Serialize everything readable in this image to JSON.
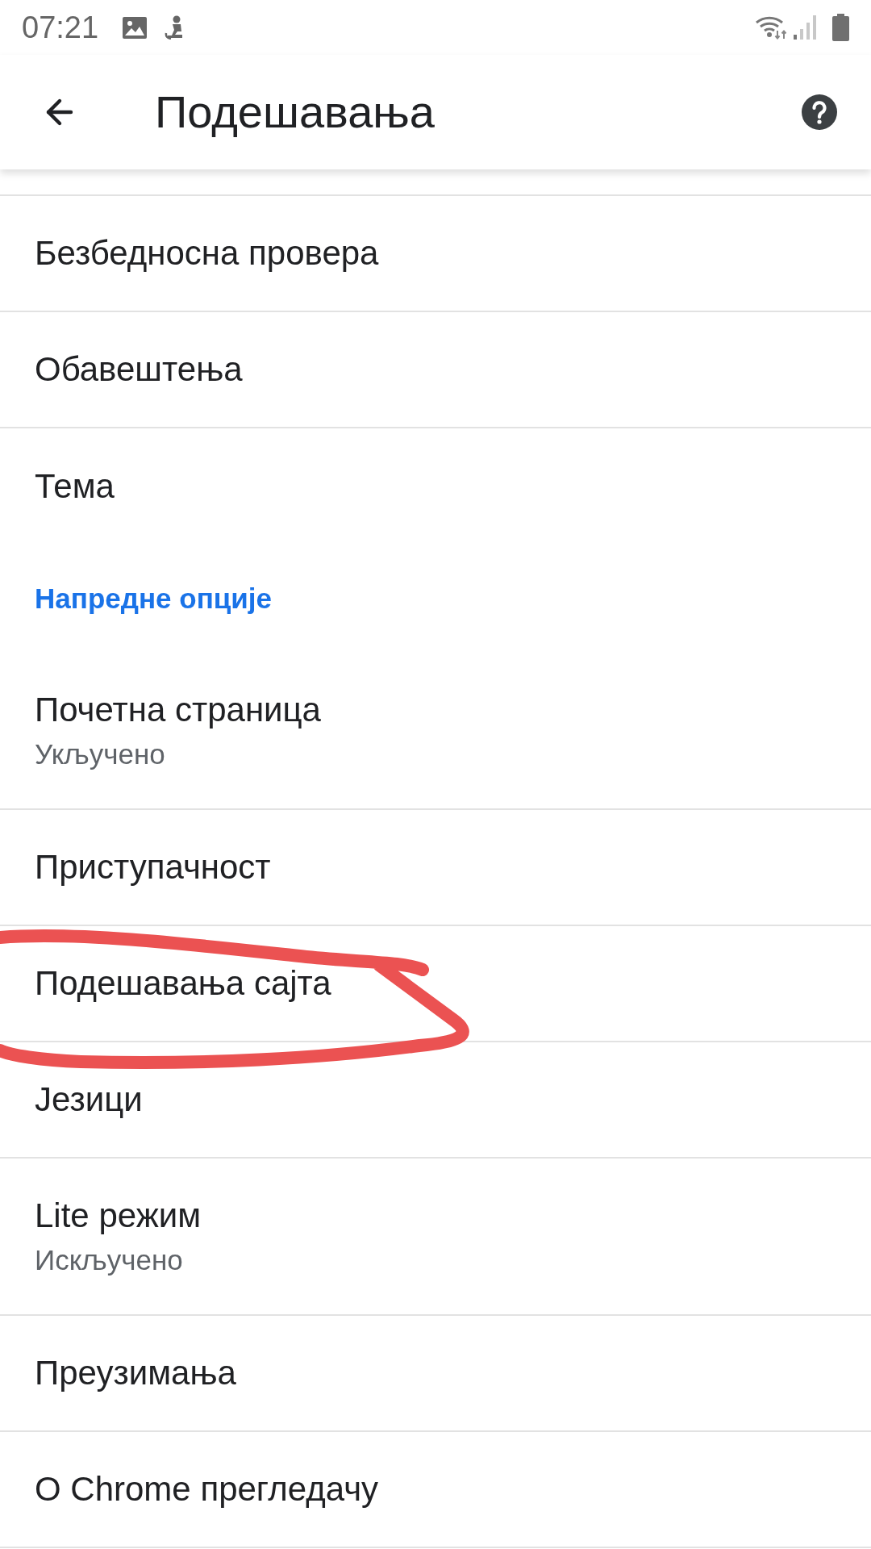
{
  "status_bar": {
    "time": "07:21"
  },
  "app_bar": {
    "title": "Подешавања"
  },
  "settings": [
    {
      "kind": "item",
      "title": "Безбедносна провера",
      "circled": false
    },
    {
      "kind": "item",
      "title": "Обавештења",
      "circled": false
    },
    {
      "kind": "item",
      "title": "Тема",
      "circled": false
    },
    {
      "kind": "header",
      "title": "Напредне опције",
      "circled": false
    },
    {
      "kind": "item",
      "title": "Почетна страница",
      "subtitle": "Укључено",
      "circled": false
    },
    {
      "kind": "item",
      "title": "Приступачност",
      "circled": false
    },
    {
      "kind": "item",
      "title": "Подешавања сајта",
      "circled": true
    },
    {
      "kind": "item",
      "title": "Језици",
      "circled": false
    },
    {
      "kind": "item",
      "title": "Lite режим",
      "subtitle": "Искључено",
      "circled": false
    },
    {
      "kind": "item",
      "title": "Преузимања",
      "circled": false
    },
    {
      "kind": "item",
      "title": "О Chrome прегледачу",
      "circled": false
    }
  ]
}
